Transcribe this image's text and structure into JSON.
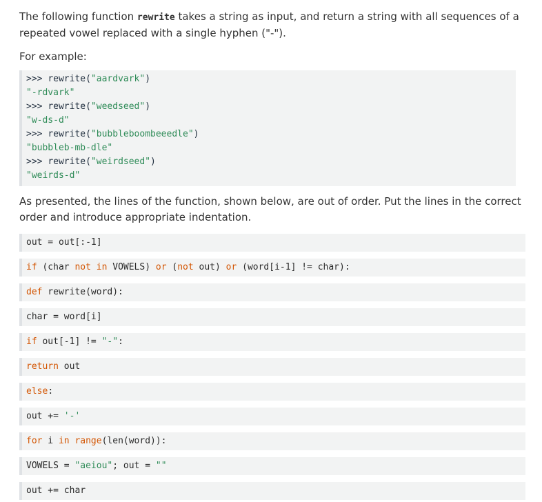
{
  "intro": {
    "text_before": "The following function ",
    "func_name": "rewrite",
    "text_after": " takes a string as input, and return a string with all sequences of a repeated vowel replaced with a single hyphen (\"-\")."
  },
  "for_example": "For example:",
  "examples": [
    {
      "prompt": ">>> ",
      "call": "rewrite(",
      "arg": "\"aardvark\"",
      "close": ")",
      "result": "\"-rdvark\""
    },
    {
      "prompt": ">>> ",
      "call": "rewrite(",
      "arg": "\"weedseed\"",
      "close": ")",
      "result": "\"w-ds-d\""
    },
    {
      "prompt": ">>> ",
      "call": "rewrite(",
      "arg": "\"bubbleboombeeedle\"",
      "close": ")",
      "result": "\"bubbleb-mb-dle\""
    },
    {
      "prompt": ">>> ",
      "call": "rewrite(",
      "arg": "\"weirdseed\"",
      "close": ")",
      "result": "\"weirds-d\""
    }
  ],
  "instructions": "As presented, the lines of the function, shown below, are out of order. Put the lines in the correct order and introduce appropriate indentation.",
  "code_lines": [
    [
      {
        "t": "out = out[:-1]",
        "c": "plain"
      }
    ],
    [
      {
        "t": "if",
        "c": "kw"
      },
      {
        "t": " (char ",
        "c": "plain"
      },
      {
        "t": "not in",
        "c": "kw"
      },
      {
        "t": " VOWELS) ",
        "c": "plain"
      },
      {
        "t": "or",
        "c": "kw"
      },
      {
        "t": " (",
        "c": "plain"
      },
      {
        "t": "not",
        "c": "kw"
      },
      {
        "t": " out) ",
        "c": "plain"
      },
      {
        "t": "or",
        "c": "kw"
      },
      {
        "t": " (word[i-1] != char):",
        "c": "plain"
      }
    ],
    [
      {
        "t": "def",
        "c": "kw"
      },
      {
        "t": " rewrite(word):",
        "c": "plain"
      }
    ],
    [
      {
        "t": "char = word[i]",
        "c": "plain"
      }
    ],
    [
      {
        "t": "if",
        "c": "kw"
      },
      {
        "t": " out[-1] != ",
        "c": "plain"
      },
      {
        "t": "\"-\"",
        "c": "str2"
      },
      {
        "t": ":",
        "c": "plain"
      }
    ],
    [
      {
        "t": "return",
        "c": "kw"
      },
      {
        "t": " out",
        "c": "plain"
      }
    ],
    [
      {
        "t": "else",
        "c": "kw"
      },
      {
        "t": ":",
        "c": "plain"
      }
    ],
    [
      {
        "t": "out += ",
        "c": "plain"
      },
      {
        "t": "'-'",
        "c": "str2"
      }
    ],
    [
      {
        "t": "for",
        "c": "kw"
      },
      {
        "t": " i ",
        "c": "plain"
      },
      {
        "t": "in",
        "c": "kw"
      },
      {
        "t": " ",
        "c": "plain"
      },
      {
        "t": "range",
        "c": "kw"
      },
      {
        "t": "(len(word)):",
        "c": "plain"
      }
    ],
    [
      {
        "t": "VOWELS = ",
        "c": "plain"
      },
      {
        "t": "\"aeiou\"",
        "c": "str2"
      },
      {
        "t": "; out = ",
        "c": "plain"
      },
      {
        "t": "\"\"",
        "c": "str2"
      }
    ],
    [
      {
        "t": "out += char",
        "c": "plain"
      }
    ]
  ]
}
